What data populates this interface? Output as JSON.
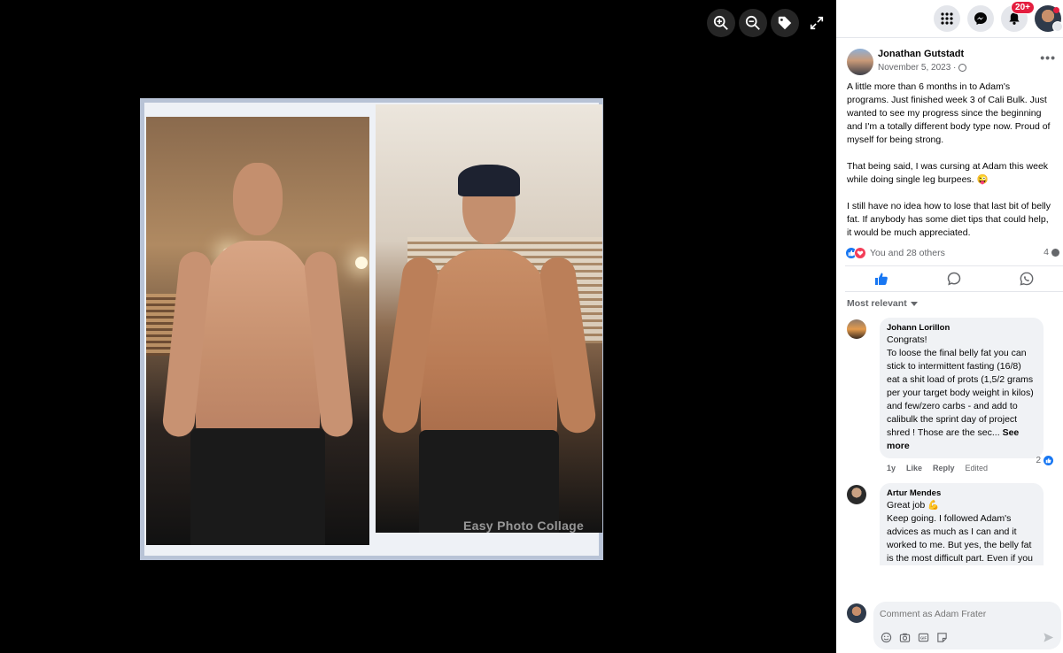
{
  "viewer": {
    "watermark": "Easy Photo Collage"
  },
  "topbar": {
    "notifications_badge": "20+"
  },
  "post": {
    "author": "Jonathan Gutstadt",
    "date": "November 5, 2023 ·",
    "paragraphs": [
      "A little more than 6 months in to Adam's programs. Just finished week 3 of Cali Bulk. Just wanted to see my progress since the beginning and I'm a totally different body type now. Proud of myself for being strong.",
      "That being said, I was cursing at Adam this week while doing single leg burpees. 😜",
      "I still have no idea how to lose that last bit of belly fat. If anybody has some diet tips that could help, it would be much appreciated."
    ],
    "reactions_text": "You and 28 others",
    "comments_count": "4"
  },
  "comments_section": {
    "sort_label": "Most relevant",
    "comments": [
      {
        "author": "Johann Lorillon",
        "text": "Congrats!\nTo loose the final belly fat you can stick to intermittent fasting (16/8) eat a shit load of prots (1,5/2 grams per your target body weight in kilos) and few/zero carbs - and add to calibulk the sprint day of project shred ! Those are the sec...",
        "see_more": "See more",
        "time": "1y",
        "like": "Like",
        "reply": "Reply",
        "edited": "Edited",
        "likes": "2"
      },
      {
        "author": "Artur Mendes",
        "text": "Great job 💪\nKeep going. I followed Adam's advices as much as I can and it worked to me. But yes, the belly fat is the most difficult part. Even if you are straight in the diet, if you go to your moms house to eat that cookie, it breaks it all..."
      }
    ]
  },
  "composer": {
    "placeholder": "Comment as Adam Frater"
  },
  "colors": {
    "accent": "#1877f2",
    "love": "#f33e58",
    "badge": "#e41e3f"
  }
}
